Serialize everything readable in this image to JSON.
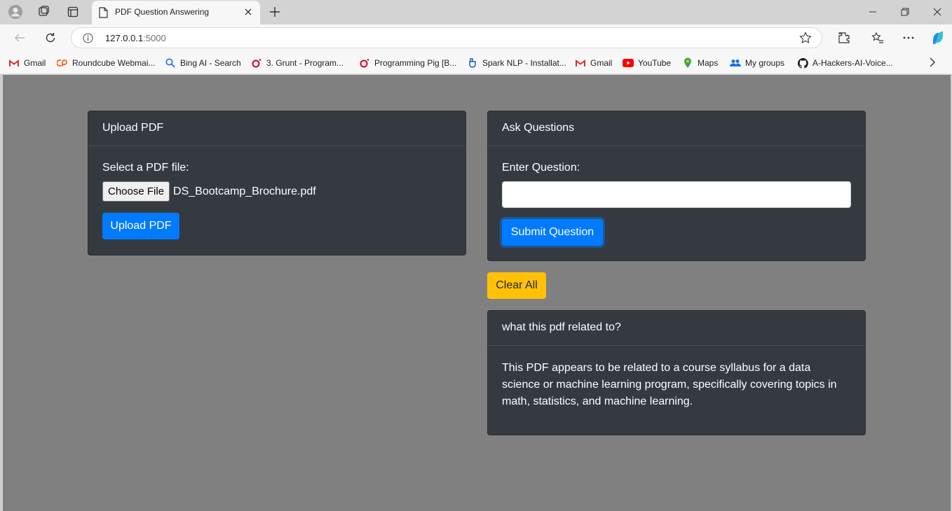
{
  "browser": {
    "tab_title": "PDF Question Answering",
    "url_host": "127.0.0.1",
    "url_port": ":5000"
  },
  "bookmarks": [
    {
      "label": "Gmail",
      "icon": "gmail-icon"
    },
    {
      "label": "Roundcube Webmai...",
      "icon": "cpanel-icon"
    },
    {
      "label": "Bing AI - Search",
      "icon": "search-icon"
    },
    {
      "label": "3. Grunt - Program...",
      "icon": "oreilly-icon"
    },
    {
      "label": "Programming Pig [B...",
      "icon": "oreilly-icon"
    },
    {
      "label": "Spark NLP - Installat...",
      "icon": "spark-icon"
    },
    {
      "label": "Gmail",
      "icon": "gmail-icon"
    },
    {
      "label": "YouTube",
      "icon": "youtube-icon"
    },
    {
      "label": "Maps",
      "icon": "maps-icon"
    },
    {
      "label": "My groups",
      "icon": "groups-icon"
    },
    {
      "label": "A-Hackers-AI-Voice...",
      "icon": "github-icon"
    }
  ],
  "upload": {
    "header": "Upload PDF",
    "select_label": "Select a PDF file:",
    "choose_button": "Choose File",
    "file_name": "DS_Bootcamp_Brochure.pdf",
    "upload_button": "Upload PDF"
  },
  "ask": {
    "header": "Ask Questions",
    "question_label": "Enter Question:",
    "question_value": "",
    "submit_button": "Submit Question"
  },
  "clear_button": "Clear All",
  "answer": {
    "question": "what this pdf related to?",
    "text": "This PDF appears to be related to a course syllabus for a data science or machine learning program, specifically covering topics in math, statistics, and machine learning."
  },
  "colors": {
    "page_bg": "#808080",
    "card_bg": "#343a40",
    "primary": "#007bff",
    "warning": "#ffc107"
  }
}
